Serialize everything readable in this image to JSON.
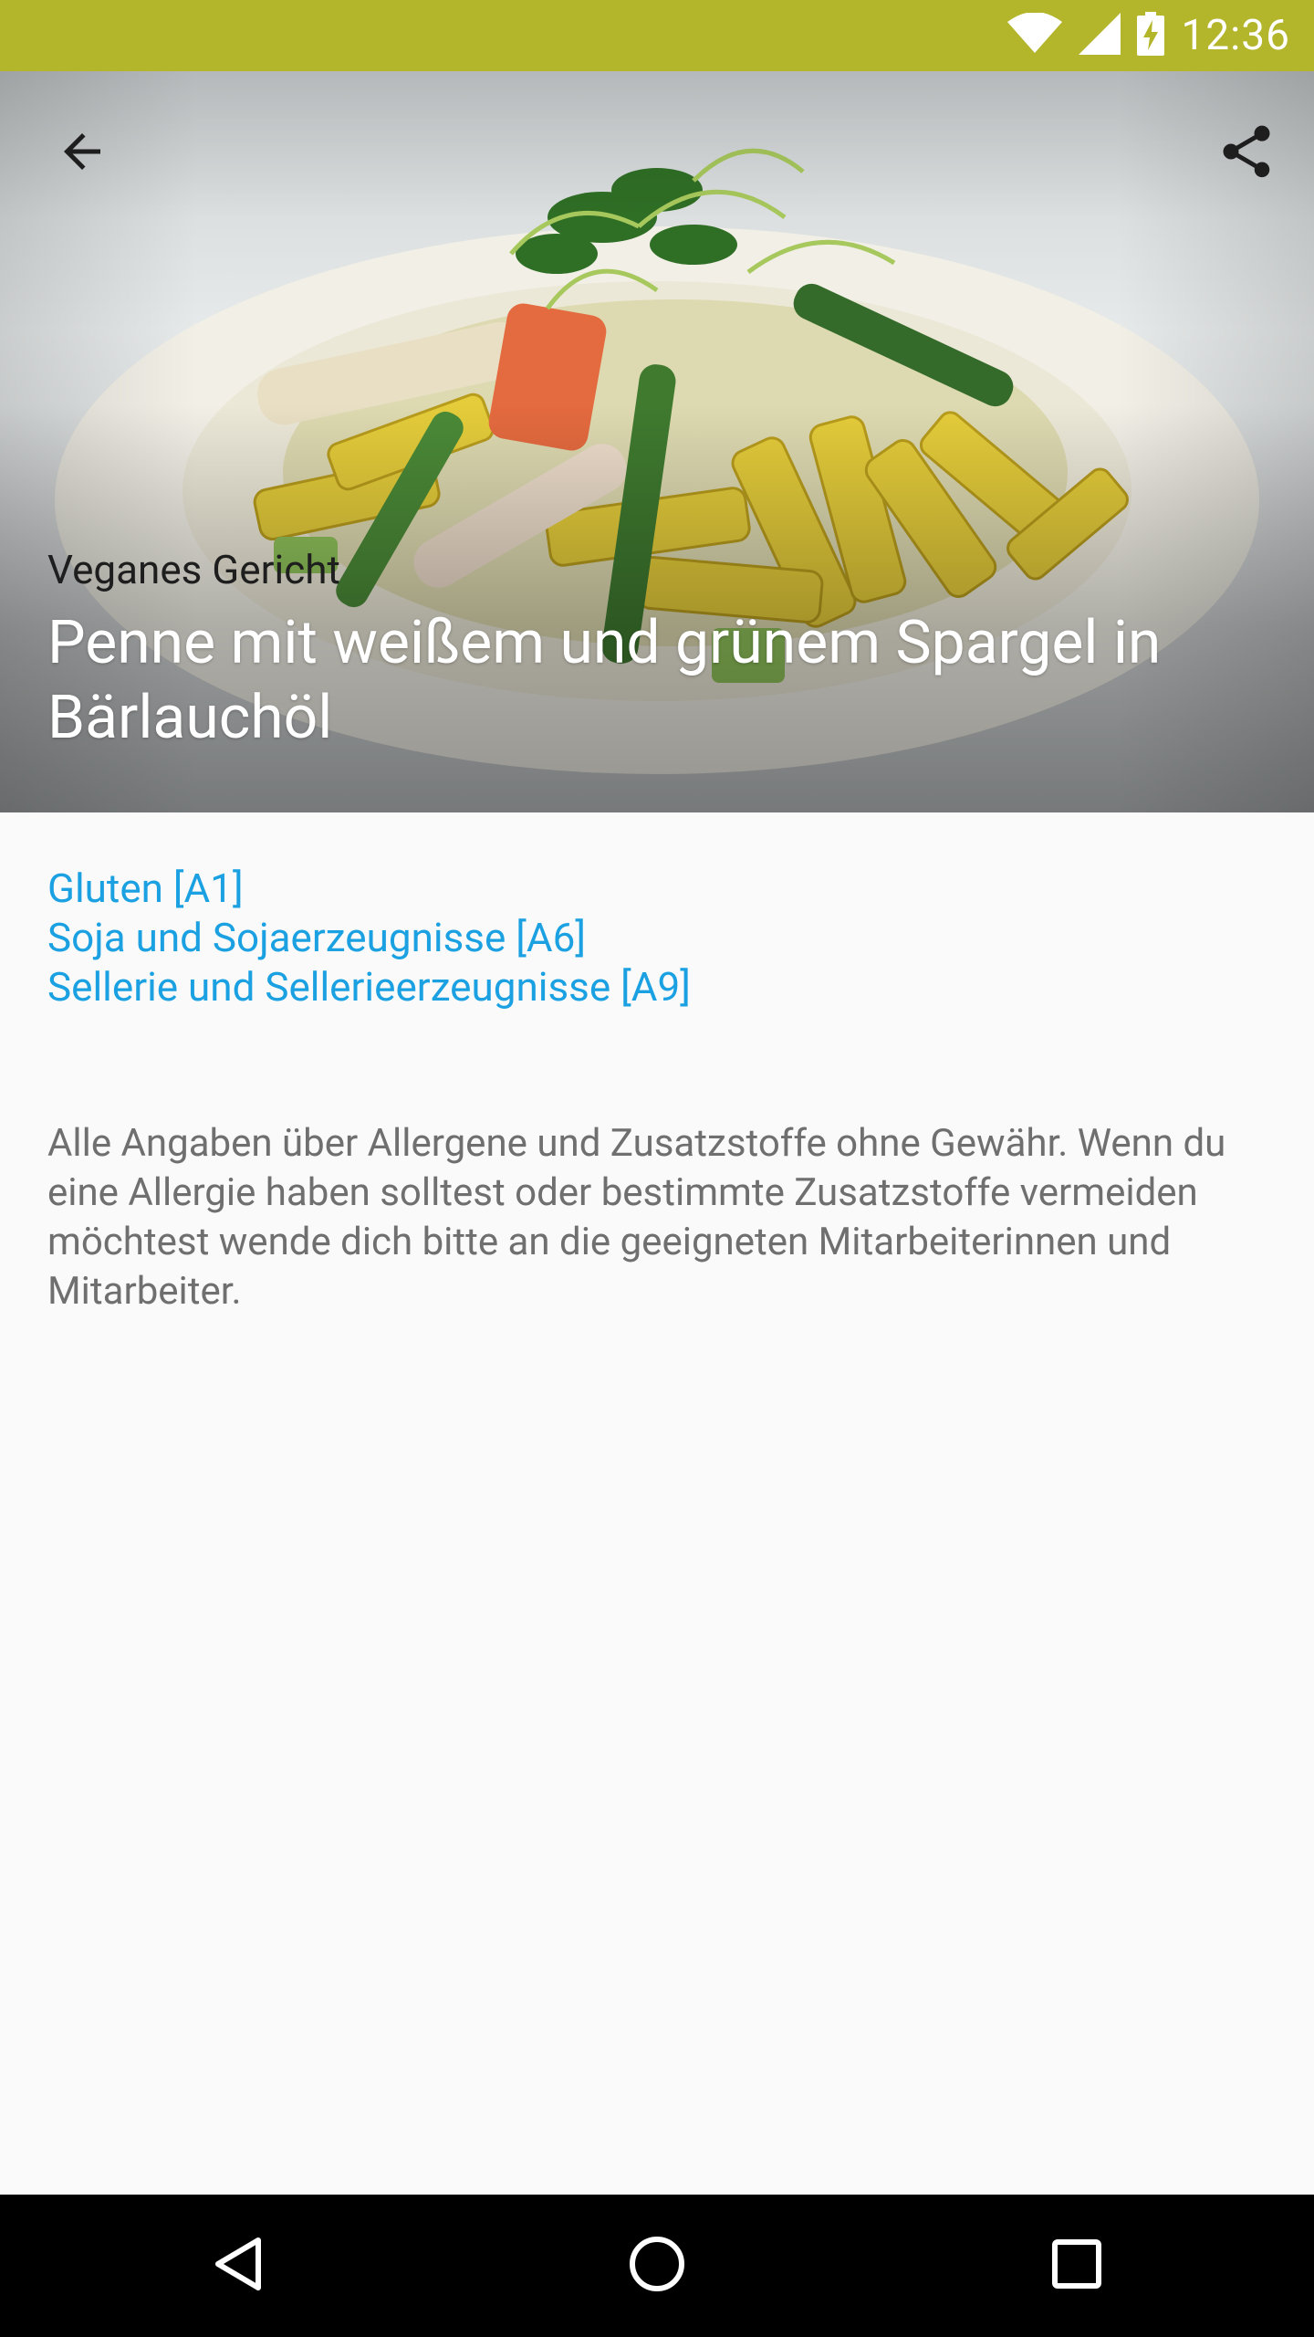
{
  "status_bar": {
    "time": "12:36",
    "icons": [
      "wifi-icon",
      "cellular-signal-icon",
      "battery-charging-icon"
    ],
    "background_color": "#b3b52b"
  },
  "toolbar": {
    "back_icon": "arrow-back-icon",
    "share_icon": "share-icon"
  },
  "meal": {
    "category": "Veganes Gericht",
    "title": "Penne mit weißem und grünem Spargel in Bärlauchöl",
    "image": "dish-photo"
  },
  "allergens": [
    "Gluten [A1]",
    "Soja und Sojaerzeugnisse [A6]",
    "Sellerie und Sellerieerzeugnisse [A9]"
  ],
  "disclaimer": "Alle Angaben über Allergene und Zusatzstoffe ohne Gewähr. Wenn du eine Allergie haben solltest oder bestimmte Zusatzstoffe vermeiden möchtest wende dich bitte an die geeigneten Mitarbeiterinnen und Mitarbeiter.",
  "colors": {
    "allergen_link": "#1ba1e2",
    "disclaimer_text": "#6f6f6f"
  },
  "nav_bar": {
    "back_icon": "nav-back-icon",
    "home_icon": "nav-home-icon",
    "recents_icon": "nav-recents-icon"
  }
}
